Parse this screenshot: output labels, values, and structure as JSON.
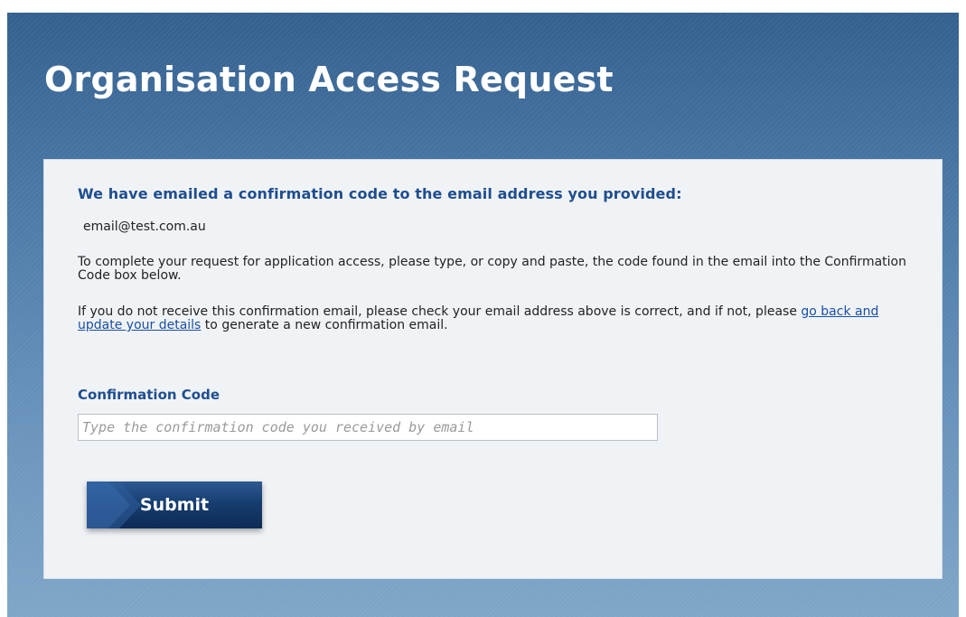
{
  "header": {
    "title": "Organisation Access Request"
  },
  "panel": {
    "heading": "We have emailed a confirmation code to the email address you provided:",
    "email": "email@test.com.au",
    "paragraph1": "To complete your request for application access, please type, or copy and paste, the code found in the email into the Confirmation Code box below.",
    "paragraph2_before": "If you do not receive this confirmation email, please check your email address above is correct, and if not, please ",
    "paragraph2_link": "go back and update your details",
    "paragraph2_after": " to generate a new confirmation email."
  },
  "form": {
    "label": "Confirmation Code",
    "placeholder": "Type the confirmation code you received by email",
    "value": ""
  },
  "actions": {
    "submit_label": "Submit",
    "submit_icon": "chevron-right-icon"
  },
  "colors": {
    "accent": "#1f4e8f",
    "link": "#1a4fa3",
    "button": "#173e70",
    "background_top": "#34608f",
    "background_bottom": "#7fa6c8"
  }
}
